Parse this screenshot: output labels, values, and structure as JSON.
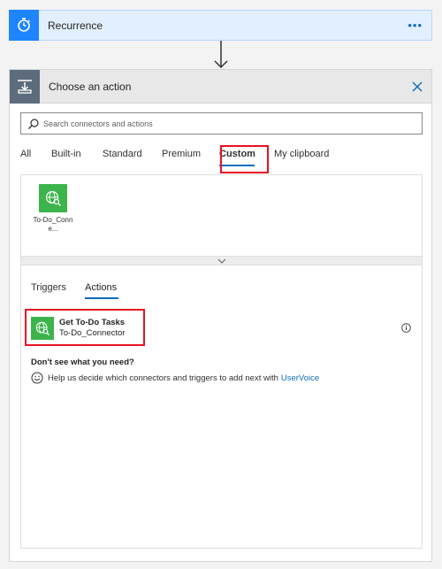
{
  "recurrence": {
    "title": "Recurrence",
    "more": "•••"
  },
  "action_card": {
    "title": "Choose an action",
    "search": {
      "placeholder": "Search connectors and actions",
      "value": ""
    },
    "tabs": [
      {
        "label": "All"
      },
      {
        "label": "Built-in"
      },
      {
        "label": "Standard"
      },
      {
        "label": "Premium"
      },
      {
        "label": "Custom"
      },
      {
        "label": "My clipboard"
      }
    ],
    "active_tab": "Custom",
    "connectors": [
      {
        "label": "To-Do_Conne..."
      }
    ],
    "sub_tabs": [
      {
        "label": "Triggers"
      },
      {
        "label": "Actions"
      }
    ],
    "active_sub_tab": "Actions",
    "actions": [
      {
        "name": "Get To-Do Tasks",
        "connector": "To-Do_Connector"
      }
    ],
    "help": {
      "title": "Don't see what you need?",
      "text": "Help us decide which connectors and triggers to add next with",
      "link": "UserVoice"
    }
  },
  "colors": {
    "recurrence_icon_bg": "#1f85ff",
    "connector_green": "#3cb44b",
    "accent": "#0f6cbd",
    "highlight": "#e81123"
  }
}
